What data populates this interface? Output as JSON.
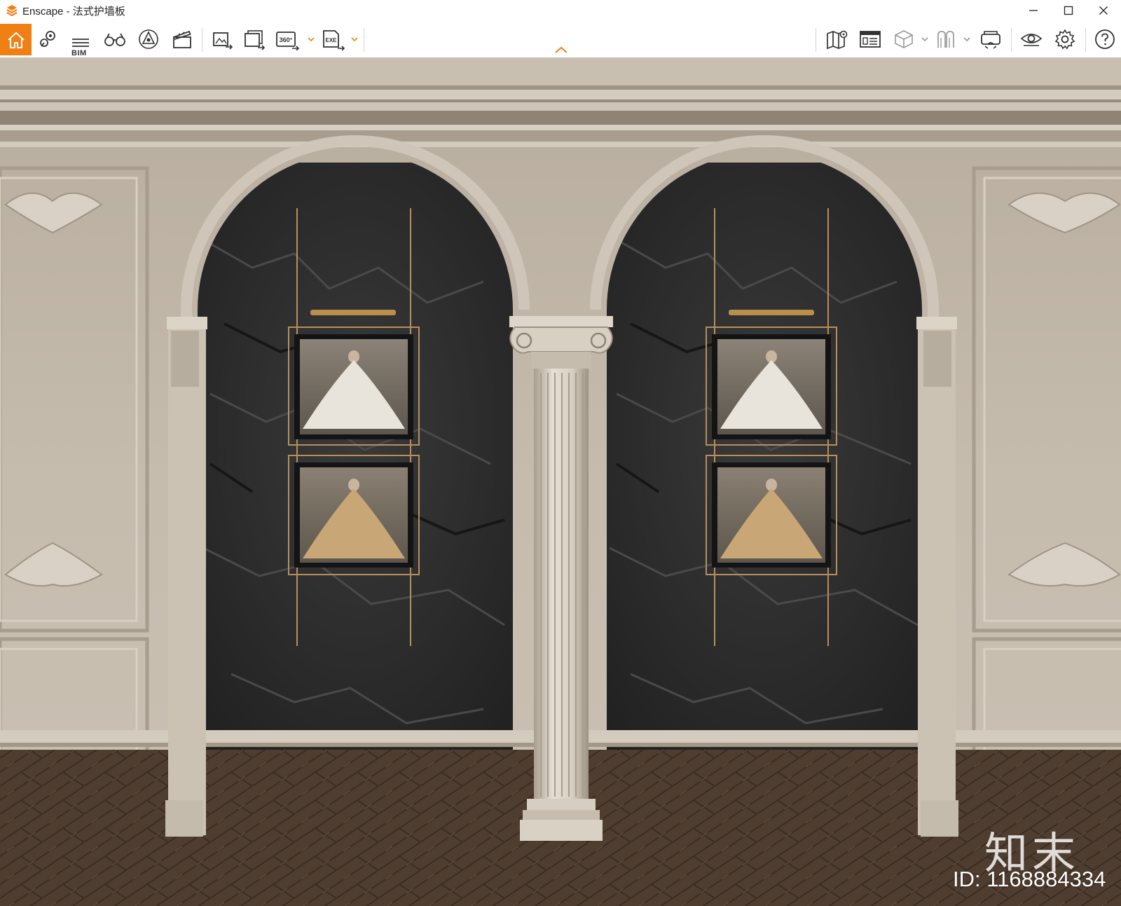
{
  "window": {
    "app_name": "Enscape",
    "title": "Enscape - 法式护墙板"
  },
  "toolbar": {
    "left_tools": [
      {
        "name": "home",
        "icon": "home-icon"
      },
      {
        "name": "favorite-views",
        "icon": "map-pin-icon"
      },
      {
        "name": "bim-info",
        "icon": "bim-icon",
        "label": "BIM"
      },
      {
        "name": "walk-mode",
        "icon": "binoculars-icon"
      },
      {
        "name": "asset-library",
        "icon": "asset-library-icon"
      },
      {
        "name": "video-editor",
        "icon": "clapperboard-icon"
      },
      {
        "name": "screenshot",
        "icon": "render-image-icon"
      },
      {
        "name": "batch-render",
        "icon": "batch-render-icon"
      },
      {
        "name": "panorama",
        "icon": "panorama-icon",
        "label": "360°"
      },
      {
        "name": "export-exe",
        "icon": "export-exe-icon",
        "label": "EXE"
      }
    ],
    "right_tools": [
      {
        "name": "map",
        "icon": "map-icon"
      },
      {
        "name": "info-panel",
        "icon": "info-panel-icon"
      },
      {
        "name": "view-cube",
        "icon": "cube-icon"
      },
      {
        "name": "materials",
        "icon": "materials-icon"
      },
      {
        "name": "vr-headset",
        "icon": "vr-headset-icon"
      },
      {
        "name": "visual-settings",
        "icon": "eye-icon"
      },
      {
        "name": "general-settings",
        "icon": "gear-icon"
      },
      {
        "name": "help",
        "icon": "help-icon"
      }
    ]
  },
  "watermark": {
    "brand": "知末",
    "id_text": "ID: 1168884334"
  },
  "colors": {
    "accent": "#f07f14",
    "wall": "#c3b9ab",
    "stone": "#2c2c2c",
    "floor": "#4d3b2e"
  }
}
